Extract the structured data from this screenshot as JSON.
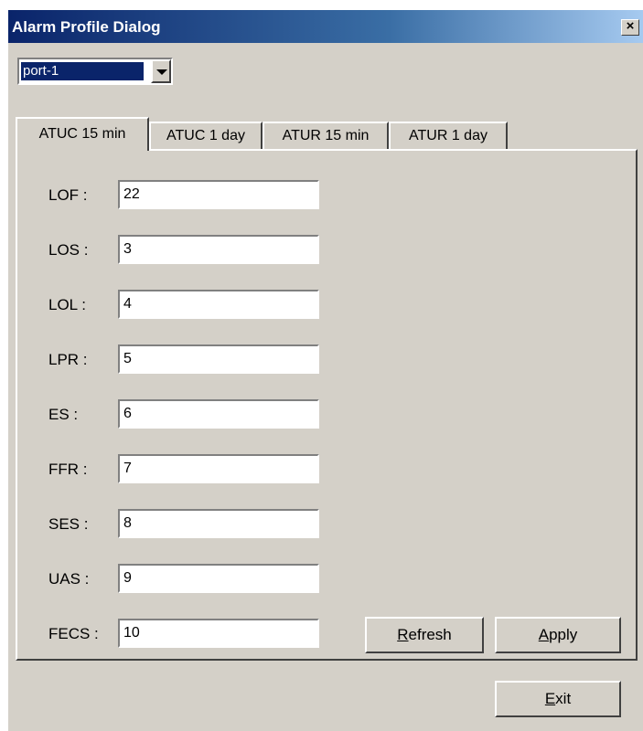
{
  "window": {
    "title": "Alarm Profile Dialog",
    "close_glyph": "×"
  },
  "port_select": {
    "value": "port-1"
  },
  "tabs": [
    {
      "label": "ATUC 15 min",
      "active": true
    },
    {
      "label": "ATUC 1 day",
      "active": false
    },
    {
      "label": "ATUR 15 min",
      "active": false
    },
    {
      "label": "ATUR 1 day",
      "active": false
    }
  ],
  "fields": [
    {
      "label": "LOF :",
      "value": "22"
    },
    {
      "label": "LOS :",
      "value": "3"
    },
    {
      "label": "LOL :",
      "value": "4"
    },
    {
      "label": "LPR :",
      "value": "5"
    },
    {
      "label": "ES :",
      "value": "6"
    },
    {
      "label": "FFR :",
      "value": "7"
    },
    {
      "label": "SES :",
      "value": "8"
    },
    {
      "label": "UAS :",
      "value": "9"
    },
    {
      "label": "FECS :",
      "value": "10"
    }
  ],
  "buttons": {
    "refresh": {
      "mnemonic": "R",
      "rest": "efresh"
    },
    "apply": {
      "mnemonic": "A",
      "rest": "pply"
    },
    "exit": {
      "mnemonic": "E",
      "rest": "xit"
    }
  }
}
